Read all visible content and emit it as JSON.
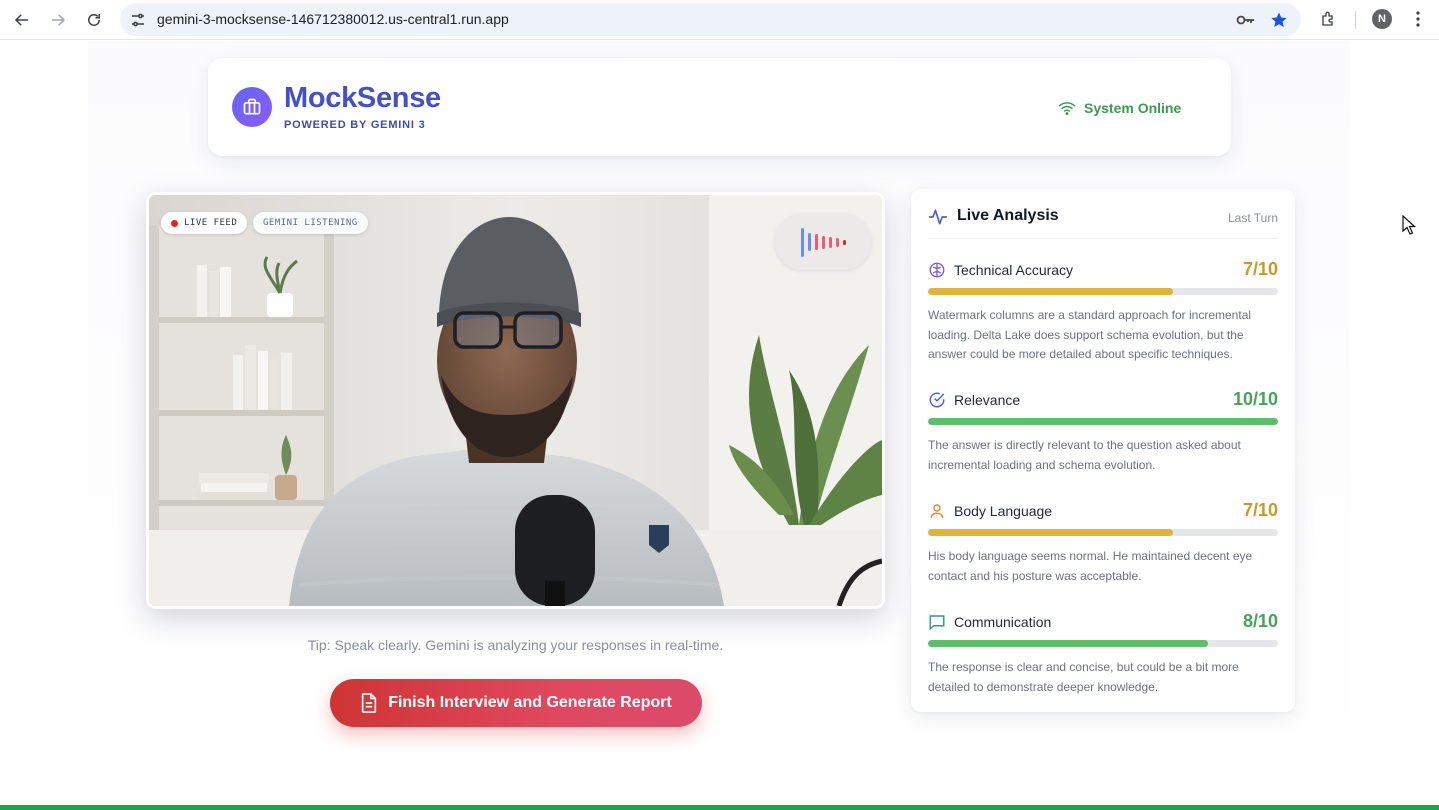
{
  "browser": {
    "url": "gemini-3-mocksense-146712380012.us-central1.run.app",
    "profile_initial": "N"
  },
  "header": {
    "brand": "MockSense",
    "subtitle": "POWERED BY GEMINI 3",
    "status": "System Online",
    "colors": {
      "brand": "#4350c8",
      "status": "#3f9a4f"
    }
  },
  "video": {
    "badge_live": "LIVE FEED",
    "badge_listening": "GEMINI LISTENING",
    "audio_bars": [
      {
        "color": "#6c8cf0",
        "level": 0.9
      },
      {
        "color": "#6c8cf0",
        "level": 0.55
      },
      {
        "color": "#ec5b7a",
        "level": 0.5
      },
      {
        "color": "#ec5b7a",
        "level": 0.4
      },
      {
        "color": "#ec5b7a",
        "level": 0.35
      },
      {
        "color": "#ec5b7a",
        "level": 0.28
      },
      {
        "color": "#dc2626",
        "level": 0.15
      }
    ]
  },
  "tip": "Tip: Speak clearly. Gemini is analyzing your responses in real-time.",
  "finish_button": "Finish Interview and Generate Report",
  "analysis": {
    "title": "Live Analysis",
    "last_turn": "Last Turn",
    "metrics": [
      {
        "label": "Technical Accuracy",
        "score": "7/10",
        "fill": 0.7,
        "icon": "brain-icon",
        "color": "#e0b33a",
        "description": "Watermark columns are a standard approach for incremental loading. Delta Lake does support schema evolution, but the answer could be more detailed about specific techniques."
      },
      {
        "label": "Relevance",
        "score": "10/10",
        "fill": 1.0,
        "icon": "check-circle-icon",
        "color": "#5cbf6a",
        "description": "The answer is directly relevant to the question asked about incremental loading and schema evolution."
      },
      {
        "label": "Body Language",
        "score": "7/10",
        "fill": 0.7,
        "icon": "person-icon",
        "color": "#e0b33a",
        "description": "His body language seems normal. He maintained decent eye contact and his posture was acceptable."
      },
      {
        "label": "Communication",
        "score": "8/10",
        "fill": 0.8,
        "icon": "chat-icon",
        "color": "#5cbf6a",
        "description": "The response is clear and concise, but could be a bit more detailed to demonstrate deeper knowledge."
      }
    ]
  }
}
